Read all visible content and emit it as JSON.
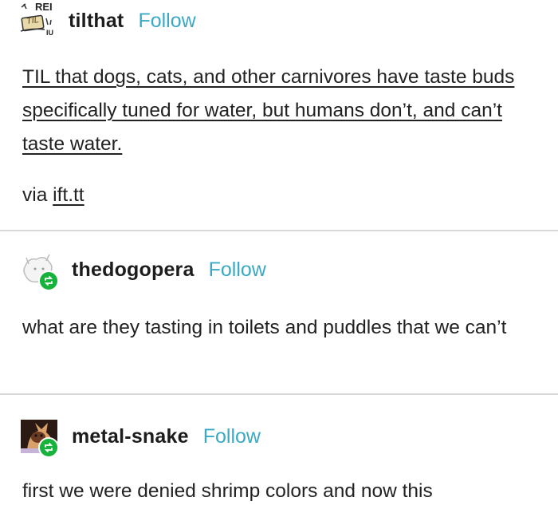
{
  "posts": [
    {
      "username": "tilthat",
      "follow_label": "Follow",
      "avatar_text": {
        "top": "REI",
        "badge": "TIL",
        "corner": "IU"
      },
      "body": "TIL that dogs, cats, and other carnivores have taste buds specifically tuned for water, but humans don’t, and can’t taste water.",
      "via_prefix": "via",
      "via_link": "ift.tt"
    },
    {
      "username": "thedogopera",
      "follow_label": "Follow",
      "body": "what are they tasting in toilets and puddles that we can’t"
    },
    {
      "username": "metal-snake",
      "follow_label": "Follow",
      "body": "first we were denied shrimp colors and now this"
    }
  ],
  "colors": {
    "follow": "#3aa9c4",
    "reblog_badge": "#16b23b",
    "divider": "#d9d9d9"
  },
  "icons": [
    "til-avatar-icon",
    "dog-avatar-icon",
    "cat-avatar-icon",
    "reblog-icon"
  ]
}
